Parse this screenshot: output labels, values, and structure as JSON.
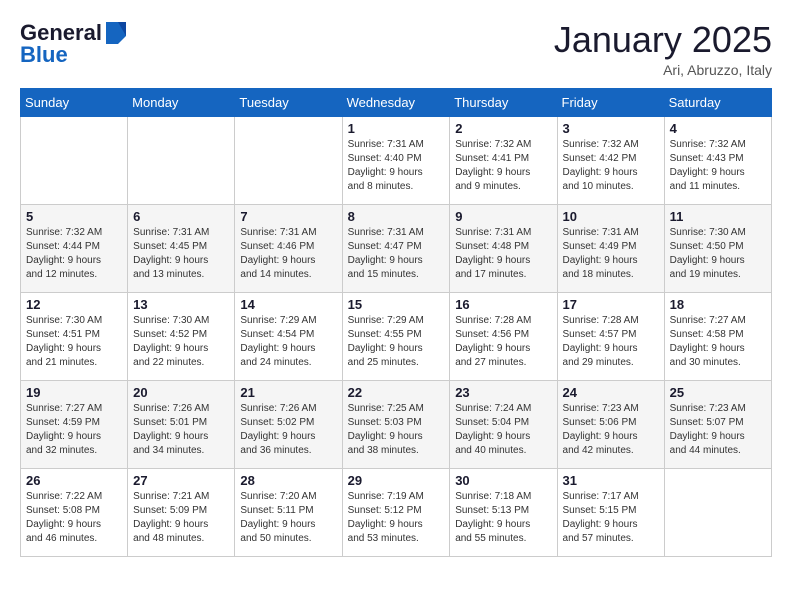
{
  "logo": {
    "line1": "General",
    "line2": "Blue"
  },
  "title": "January 2025",
  "location": "Ari, Abruzzo, Italy",
  "weekdays": [
    "Sunday",
    "Monday",
    "Tuesday",
    "Wednesday",
    "Thursday",
    "Friday",
    "Saturday"
  ],
  "weeks": [
    [
      {
        "day": "",
        "info": ""
      },
      {
        "day": "",
        "info": ""
      },
      {
        "day": "",
        "info": ""
      },
      {
        "day": "1",
        "info": "Sunrise: 7:31 AM\nSunset: 4:40 PM\nDaylight: 9 hours\nand 8 minutes."
      },
      {
        "day": "2",
        "info": "Sunrise: 7:32 AM\nSunset: 4:41 PM\nDaylight: 9 hours\nand 9 minutes."
      },
      {
        "day": "3",
        "info": "Sunrise: 7:32 AM\nSunset: 4:42 PM\nDaylight: 9 hours\nand 10 minutes."
      },
      {
        "day": "4",
        "info": "Sunrise: 7:32 AM\nSunset: 4:43 PM\nDaylight: 9 hours\nand 11 minutes."
      }
    ],
    [
      {
        "day": "5",
        "info": "Sunrise: 7:32 AM\nSunset: 4:44 PM\nDaylight: 9 hours\nand 12 minutes."
      },
      {
        "day": "6",
        "info": "Sunrise: 7:31 AM\nSunset: 4:45 PM\nDaylight: 9 hours\nand 13 minutes."
      },
      {
        "day": "7",
        "info": "Sunrise: 7:31 AM\nSunset: 4:46 PM\nDaylight: 9 hours\nand 14 minutes."
      },
      {
        "day": "8",
        "info": "Sunrise: 7:31 AM\nSunset: 4:47 PM\nDaylight: 9 hours\nand 15 minutes."
      },
      {
        "day": "9",
        "info": "Sunrise: 7:31 AM\nSunset: 4:48 PM\nDaylight: 9 hours\nand 17 minutes."
      },
      {
        "day": "10",
        "info": "Sunrise: 7:31 AM\nSunset: 4:49 PM\nDaylight: 9 hours\nand 18 minutes."
      },
      {
        "day": "11",
        "info": "Sunrise: 7:30 AM\nSunset: 4:50 PM\nDaylight: 9 hours\nand 19 minutes."
      }
    ],
    [
      {
        "day": "12",
        "info": "Sunrise: 7:30 AM\nSunset: 4:51 PM\nDaylight: 9 hours\nand 21 minutes."
      },
      {
        "day": "13",
        "info": "Sunrise: 7:30 AM\nSunset: 4:52 PM\nDaylight: 9 hours\nand 22 minutes."
      },
      {
        "day": "14",
        "info": "Sunrise: 7:29 AM\nSunset: 4:54 PM\nDaylight: 9 hours\nand 24 minutes."
      },
      {
        "day": "15",
        "info": "Sunrise: 7:29 AM\nSunset: 4:55 PM\nDaylight: 9 hours\nand 25 minutes."
      },
      {
        "day": "16",
        "info": "Sunrise: 7:28 AM\nSunset: 4:56 PM\nDaylight: 9 hours\nand 27 minutes."
      },
      {
        "day": "17",
        "info": "Sunrise: 7:28 AM\nSunset: 4:57 PM\nDaylight: 9 hours\nand 29 minutes."
      },
      {
        "day": "18",
        "info": "Sunrise: 7:27 AM\nSunset: 4:58 PM\nDaylight: 9 hours\nand 30 minutes."
      }
    ],
    [
      {
        "day": "19",
        "info": "Sunrise: 7:27 AM\nSunset: 4:59 PM\nDaylight: 9 hours\nand 32 minutes."
      },
      {
        "day": "20",
        "info": "Sunrise: 7:26 AM\nSunset: 5:01 PM\nDaylight: 9 hours\nand 34 minutes."
      },
      {
        "day": "21",
        "info": "Sunrise: 7:26 AM\nSunset: 5:02 PM\nDaylight: 9 hours\nand 36 minutes."
      },
      {
        "day": "22",
        "info": "Sunrise: 7:25 AM\nSunset: 5:03 PM\nDaylight: 9 hours\nand 38 minutes."
      },
      {
        "day": "23",
        "info": "Sunrise: 7:24 AM\nSunset: 5:04 PM\nDaylight: 9 hours\nand 40 minutes."
      },
      {
        "day": "24",
        "info": "Sunrise: 7:23 AM\nSunset: 5:06 PM\nDaylight: 9 hours\nand 42 minutes."
      },
      {
        "day": "25",
        "info": "Sunrise: 7:23 AM\nSunset: 5:07 PM\nDaylight: 9 hours\nand 44 minutes."
      }
    ],
    [
      {
        "day": "26",
        "info": "Sunrise: 7:22 AM\nSunset: 5:08 PM\nDaylight: 9 hours\nand 46 minutes."
      },
      {
        "day": "27",
        "info": "Sunrise: 7:21 AM\nSunset: 5:09 PM\nDaylight: 9 hours\nand 48 minutes."
      },
      {
        "day": "28",
        "info": "Sunrise: 7:20 AM\nSunset: 5:11 PM\nDaylight: 9 hours\nand 50 minutes."
      },
      {
        "day": "29",
        "info": "Sunrise: 7:19 AM\nSunset: 5:12 PM\nDaylight: 9 hours\nand 53 minutes."
      },
      {
        "day": "30",
        "info": "Sunrise: 7:18 AM\nSunset: 5:13 PM\nDaylight: 9 hours\nand 55 minutes."
      },
      {
        "day": "31",
        "info": "Sunrise: 7:17 AM\nSunset: 5:15 PM\nDaylight: 9 hours\nand 57 minutes."
      },
      {
        "day": "",
        "info": ""
      }
    ]
  ]
}
